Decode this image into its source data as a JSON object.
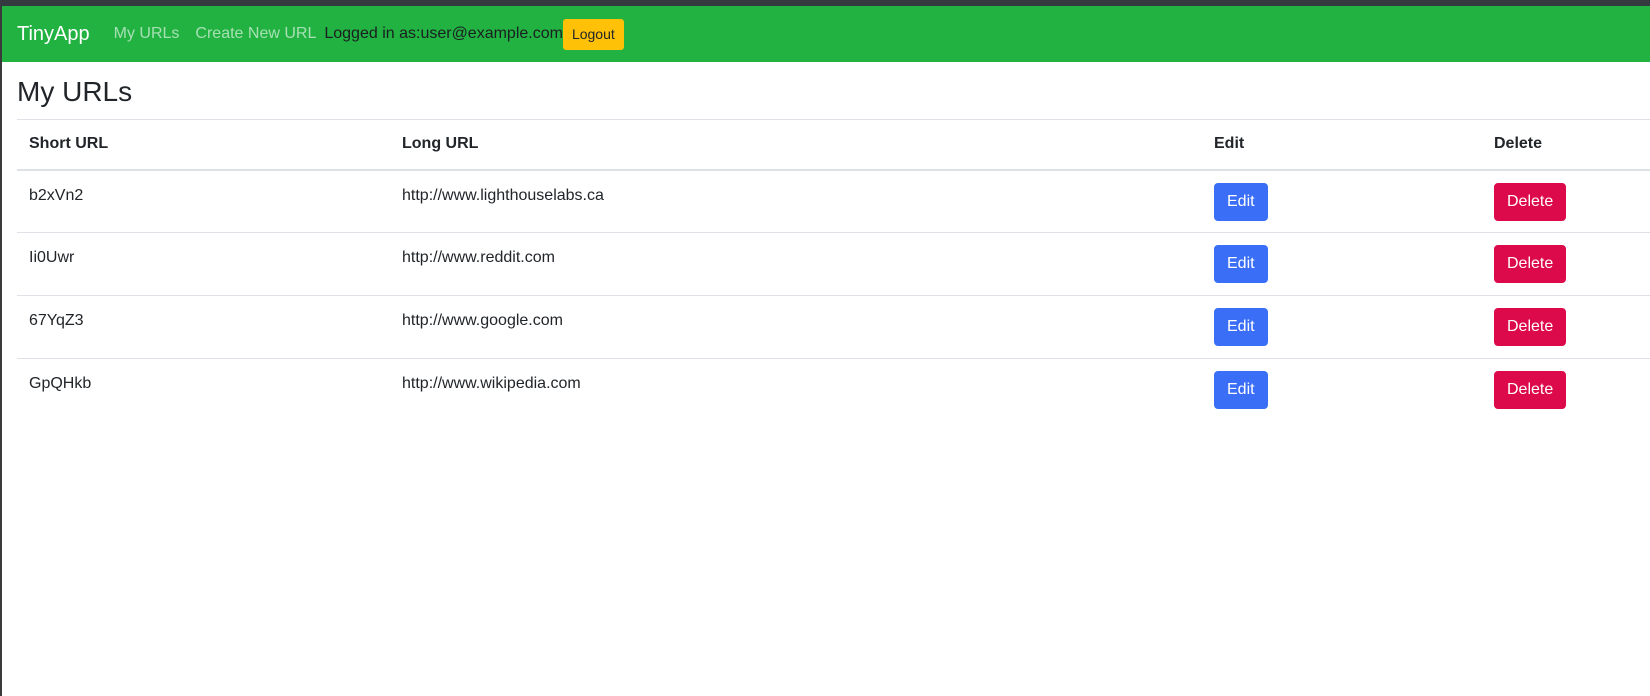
{
  "navbar": {
    "brand": "TinyApp",
    "links": [
      {
        "label": "My URLs"
      },
      {
        "label": "Create New URL"
      }
    ],
    "logged_in_text": "Logged in as:user@example.com",
    "logout_label": "Logout"
  },
  "page": {
    "title": "My URLs"
  },
  "table": {
    "headers": [
      "Short URL",
      "Long URL",
      "Edit",
      "Delete"
    ],
    "rows": [
      {
        "short": "b2xVn2",
        "long": "http://www.lighthouselabs.ca",
        "edit": "Edit",
        "delete": "Delete"
      },
      {
        "short": "Ii0Uwr",
        "long": "http://www.reddit.com",
        "edit": "Edit",
        "delete": "Delete"
      },
      {
        "short": "67YqZ3",
        "long": "http://www.google.com",
        "edit": "Edit",
        "delete": "Delete"
      },
      {
        "short": "GpQHkb",
        "long": "http://www.wikipedia.com",
        "edit": "Edit",
        "delete": "Delete"
      }
    ]
  },
  "colors": {
    "navbar": "#22b242",
    "edit_button": "#3a6ef6",
    "delete_button": "#dc0a4a",
    "logout_button": "#ffc107"
  }
}
